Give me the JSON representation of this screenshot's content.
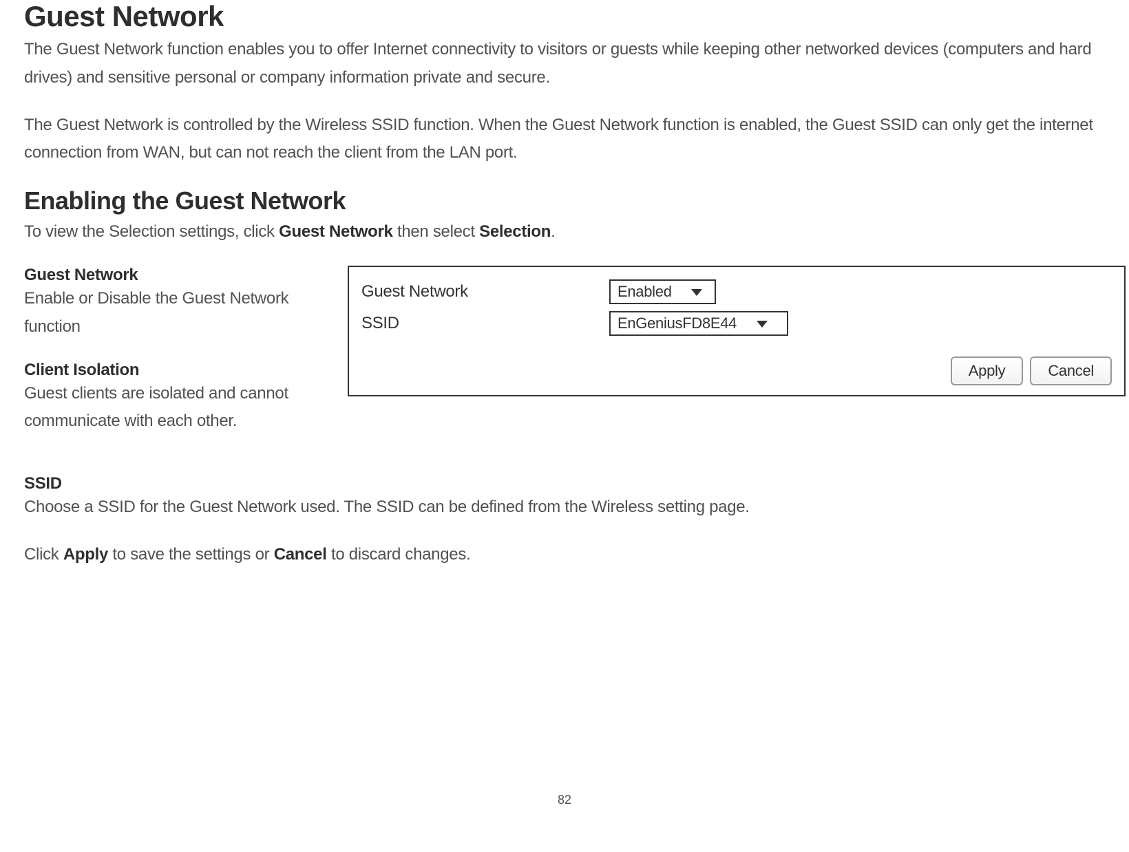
{
  "page": {
    "number": "82"
  },
  "headings": {
    "main": "Guest Network",
    "enabling": "Enabling the Guest Network"
  },
  "intro": {
    "p1": "The Guest Network function enables you to offer Internet connectivity to visitors or guests while keeping other networked devices (computers and hard drives) and sensitive personal or company information private and secure.",
    "p2": "The Guest Network is controlled by the Wireless SSID function. When the Guest Network function is enabled, the Guest SSID can only get the internet connection from WAN, but can not reach the client from the LAN port."
  },
  "instruction": {
    "prefix": "To view the Selection settings, click ",
    "bold1": "Guest Network",
    "mid": " then select ",
    "bold2": "Selection",
    "suffix": "."
  },
  "definitions": {
    "guestNetwork": {
      "title": "Guest Network",
      "desc": "Enable or Disable the Guest Network function"
    },
    "clientIsolation": {
      "title": "Client Isolation",
      "desc": "Guest clients are isolated and cannot communicate with each other."
    },
    "ssid": {
      "title": "SSID",
      "desc": "Choose a SSID for the Guest Network used. The SSID can be defined from the Wireless setting page."
    }
  },
  "panel": {
    "labels": {
      "guestNetwork": "Guest Network",
      "ssid": "SSID"
    },
    "values": {
      "guestNetwork": "Enabled",
      "ssid": "EnGeniusFD8E44"
    },
    "buttons": {
      "apply": "Apply",
      "cancel": "Cancel"
    }
  },
  "footer": {
    "prefix": "Click ",
    "bold1": "Apply",
    "mid": " to save the settings or ",
    "bold2": "Cancel",
    "suffix": " to discard changes."
  }
}
